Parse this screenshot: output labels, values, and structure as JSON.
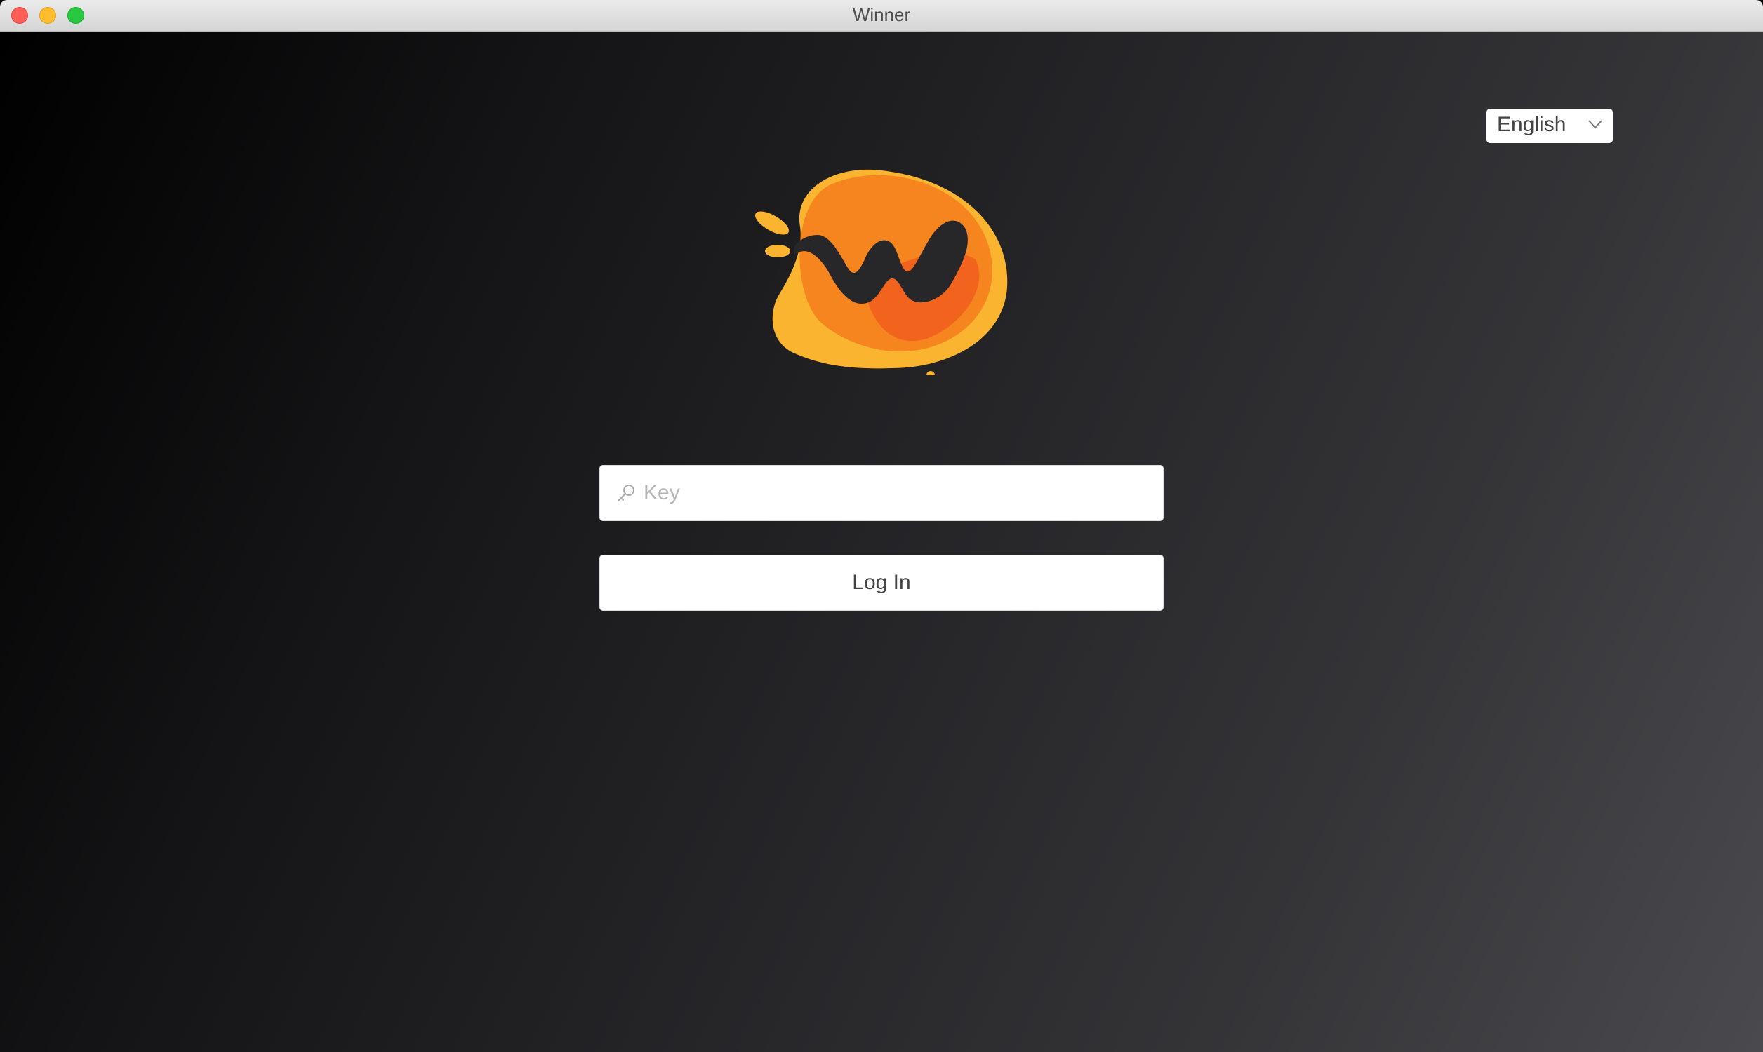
{
  "window": {
    "title": "Winner"
  },
  "language_select": {
    "selected": "English",
    "icon": "chevron-down-icon"
  },
  "login": {
    "key_placeholder": "Key",
    "key_value": "",
    "key_icon": "key-icon",
    "login_label": "Log In"
  },
  "colors": {
    "background_dark": "#000000",
    "background_light": "#4a4a4e",
    "logo_orange": "#f5821f",
    "logo_yellow": "#fbb430",
    "logo_deep_orange": "#f05a1e"
  }
}
